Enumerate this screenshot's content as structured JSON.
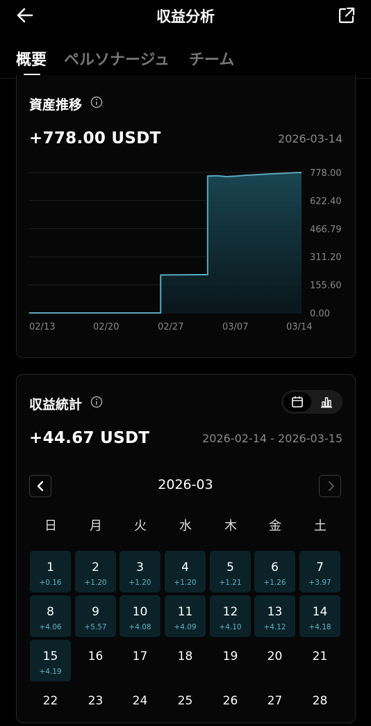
{
  "header": {
    "title": "収益分析",
    "back_icon": "arrow-left-icon",
    "share_icon": "external-link-icon"
  },
  "tabs": [
    {
      "label": "概要",
      "active": true
    },
    {
      "label": "ペルソナージュ",
      "active": false
    },
    {
      "label": "チーム",
      "active": false
    }
  ],
  "asset": {
    "title": "資産推移",
    "amount": "+778.00 USDT",
    "date": "2026-03-14",
    "chart_data": {
      "type": "area",
      "title": "",
      "xlabel": "",
      "ylabel": "",
      "x_ticks": [
        "02/13",
        "02/20",
        "02/27",
        "03/07",
        "03/14"
      ],
      "y_ticks": [
        "778.00",
        "622.40",
        "466.79",
        "311.20",
        "155.60",
        "0.00"
      ],
      "ylim": [
        0,
        778
      ],
      "grid": true,
      "series": [
        {
          "color": "#5aa9bd",
          "points": [
            {
              "x": "2026-02-13",
              "y": 0
            },
            {
              "x": "2026-02-26",
              "y": 0
            },
            {
              "x": "2026-02-27",
              "y": 210
            },
            {
              "x": "2026-03-03",
              "y": 212
            },
            {
              "x": "2026-03-04",
              "y": 758
            },
            {
              "x": "2026-03-05",
              "y": 760
            },
            {
              "x": "2026-03-06",
              "y": 755
            },
            {
              "x": "2026-03-07",
              "y": 758
            },
            {
              "x": "2026-03-08",
              "y": 762
            },
            {
              "x": "2026-03-09",
              "y": 765
            },
            {
              "x": "2026-03-10",
              "y": 768
            },
            {
              "x": "2026-03-11",
              "y": 771
            },
            {
              "x": "2026-03-12",
              "y": 773
            },
            {
              "x": "2026-03-13",
              "y": 776
            },
            {
              "x": "2026-03-14",
              "y": 778
            }
          ]
        }
      ]
    }
  },
  "earnings": {
    "title": "収益統計",
    "amount": "+44.67 USDT",
    "range": "2026-02-14 - 2026-03-15",
    "toggle": [
      {
        "icon": "calendar-icon",
        "active": true
      },
      {
        "icon": "bar-chart-icon",
        "active": false
      }
    ],
    "month": "2026-03",
    "weekdays": [
      "日",
      "月",
      "火",
      "水",
      "木",
      "金",
      "土"
    ],
    "days": [
      {
        "d": "1",
        "e": "+0.16"
      },
      {
        "d": "2",
        "e": "+1.20"
      },
      {
        "d": "3",
        "e": "+1.20"
      },
      {
        "d": "4",
        "e": "+1.20"
      },
      {
        "d": "5",
        "e": "+1.21"
      },
      {
        "d": "6",
        "e": "+1.26"
      },
      {
        "d": "7",
        "e": "+3.97"
      },
      {
        "d": "8",
        "e": "+4.06"
      },
      {
        "d": "9",
        "e": "+5.57"
      },
      {
        "d": "10",
        "e": "+4.08"
      },
      {
        "d": "11",
        "e": "+4.09"
      },
      {
        "d": "12",
        "e": "+4.10"
      },
      {
        "d": "13",
        "e": "+4.12"
      },
      {
        "d": "14",
        "e": "+4.18"
      },
      {
        "d": "15",
        "e": "+4.19"
      },
      {
        "d": "16",
        "e": ""
      },
      {
        "d": "17",
        "e": ""
      },
      {
        "d": "18",
        "e": ""
      },
      {
        "d": "19",
        "e": ""
      },
      {
        "d": "20",
        "e": ""
      },
      {
        "d": "21",
        "e": ""
      },
      {
        "d": "22",
        "e": ""
      },
      {
        "d": "23",
        "e": ""
      },
      {
        "d": "24",
        "e": ""
      },
      {
        "d": "25",
        "e": ""
      },
      {
        "d": "26",
        "e": ""
      },
      {
        "d": "27",
        "e": ""
      },
      {
        "d": "28",
        "e": ""
      }
    ]
  }
}
